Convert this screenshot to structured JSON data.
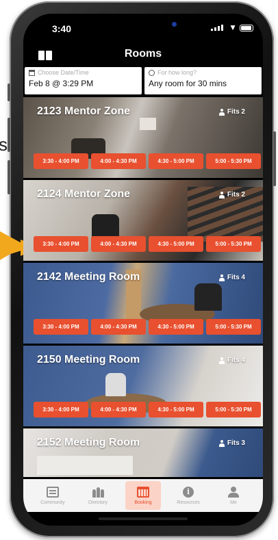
{
  "background": {
    "fragment_text": "s."
  },
  "status_bar": {
    "time": "3:40"
  },
  "nav": {
    "title": "Rooms"
  },
  "filters": {
    "date": {
      "placeholder": "Choose Date/Time",
      "value": "Feb 8 @ 3:29 PM"
    },
    "duration": {
      "placeholder": "For how long?",
      "value": "Any room for 30 mins"
    }
  },
  "rooms": [
    {
      "name": "2123 Mentor Zone",
      "fits": "Fits 2",
      "slots": [
        "3:30 - 4:00 PM",
        "4:00 - 4:30 PM",
        "4:30 - 5:00 PM",
        "5:00 - 5:30 PM"
      ]
    },
    {
      "name": "2124 Mentor Zone",
      "fits": "Fits 2",
      "slots": [
        "3:30 - 4:00 PM",
        "4:00 - 4:30 PM",
        "4:30 - 5:00 PM",
        "5:00 - 5:30 PM"
      ]
    },
    {
      "name": "2142 Meeting Room",
      "fits": "Fits 4",
      "slots": [
        "3:30 - 4:00 PM",
        "4:00 - 4:30 PM",
        "4:30 - 5:00 PM",
        "5:00 - 5:30 PM"
      ]
    },
    {
      "name": "2150 Meeting Room",
      "fits": "Fits 4",
      "slots": [
        "3:30 - 4:00 PM",
        "4:00 - 4:30 PM",
        "4:30 - 5:00 PM",
        "5:00 - 5:30 PM"
      ]
    },
    {
      "name": "2152 Meeting Room",
      "fits": "Fits 3",
      "slots": []
    }
  ],
  "tabs": [
    {
      "label": "Community",
      "icon": "community-icon",
      "active": false
    },
    {
      "label": "Directory",
      "icon": "directory-icon",
      "active": false
    },
    {
      "label": "Booking",
      "icon": "booking-icon",
      "active": true
    },
    {
      "label": "Resources",
      "icon": "resources-icon",
      "active": false
    },
    {
      "label": "Me",
      "icon": "me-icon",
      "active": false
    }
  ],
  "colors": {
    "accent": "#e8502f",
    "accent_light": "#fbd3c7",
    "arrow": "#f2a81d"
  }
}
